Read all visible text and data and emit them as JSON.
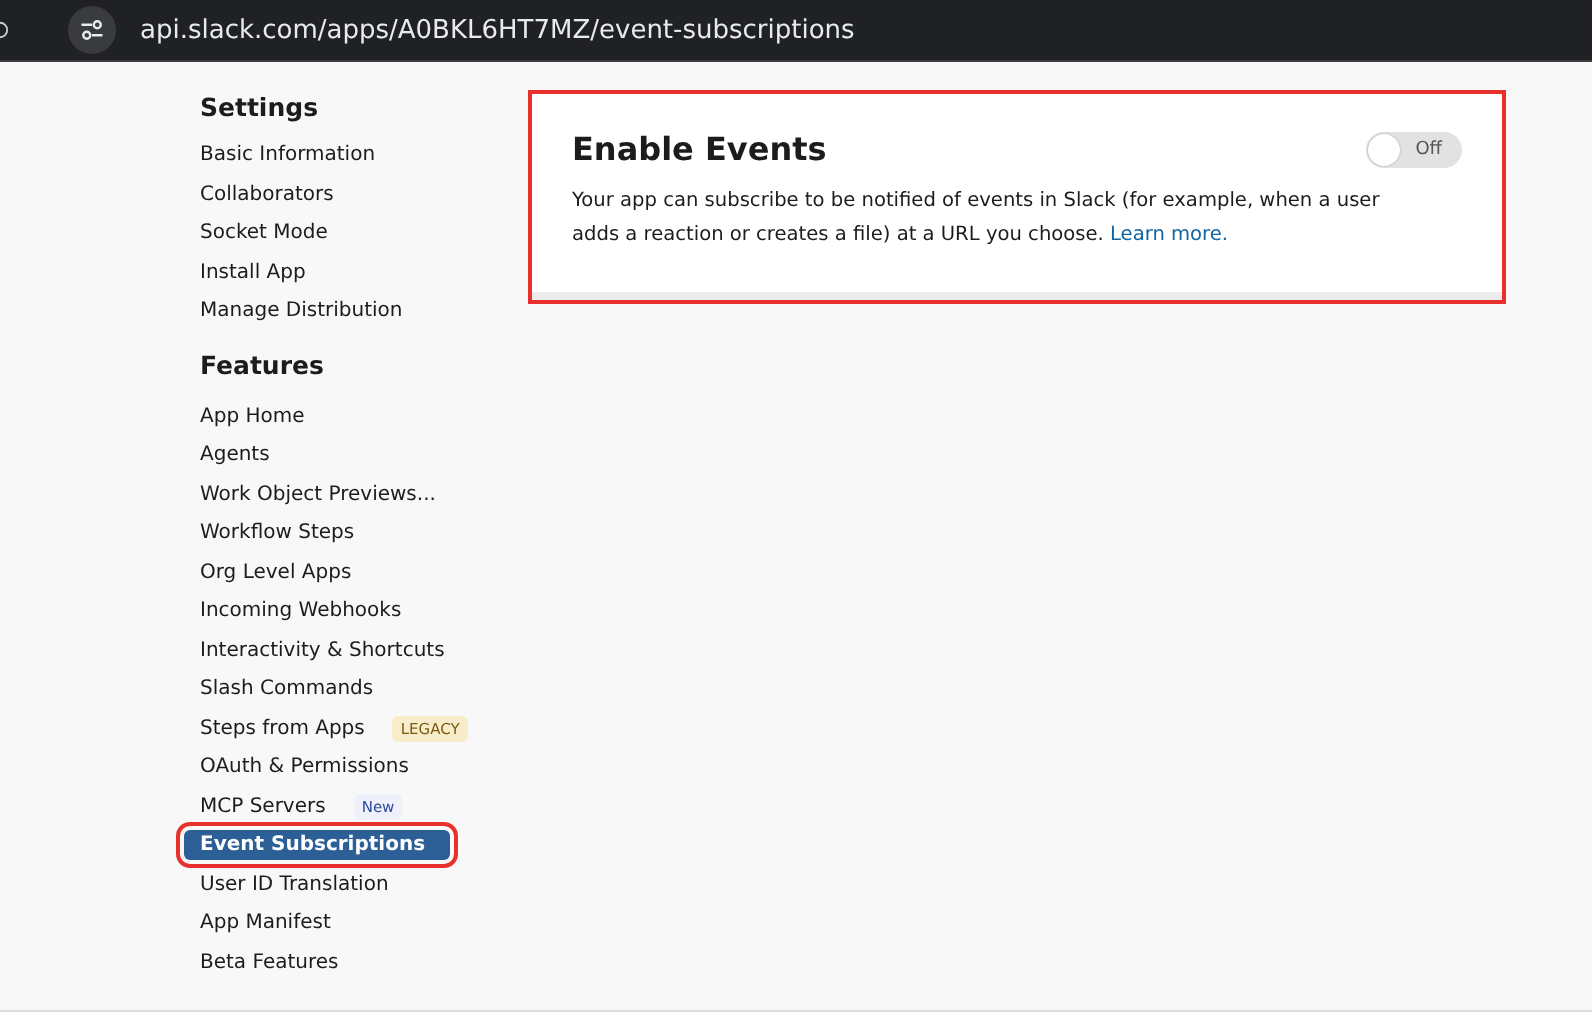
{
  "address_bar": {
    "url": "api.slack.com/apps/A0BKL6HT7MZ/event-subscriptions"
  },
  "sidebar": {
    "sections": [
      {
        "title": "Settings",
        "items": [
          {
            "label": "Basic Information",
            "selected": false
          },
          {
            "label": "Collaborators",
            "selected": false
          },
          {
            "label": "Socket Mode",
            "selected": false
          },
          {
            "label": "Install App",
            "selected": false
          },
          {
            "label": "Manage Distribution",
            "selected": false
          }
        ]
      },
      {
        "title": "Features",
        "items": [
          {
            "label": "App Home",
            "selected": false
          },
          {
            "label": "Agents",
            "selected": false
          },
          {
            "label": "Work Object Previews...",
            "selected": false
          },
          {
            "label": "Workflow Steps",
            "selected": false
          },
          {
            "label": "Org Level Apps",
            "selected": false
          },
          {
            "label": "Incoming Webhooks",
            "selected": false
          },
          {
            "label": "Interactivity & Shortcuts",
            "selected": false
          },
          {
            "label": "Slash Commands",
            "selected": false
          },
          {
            "label": "Steps from Apps",
            "selected": false,
            "badge": "LEGACY",
            "kind": "legacy"
          },
          {
            "label": "OAuth & Permissions",
            "selected": false
          },
          {
            "label": "MCP Servers",
            "selected": false,
            "badge": "New",
            "kind": "new"
          },
          {
            "label": "Event Subscriptions",
            "selected": true
          },
          {
            "label": "User ID Translation",
            "selected": false
          },
          {
            "label": "App Manifest",
            "selected": false
          },
          {
            "label": "Beta Features",
            "selected": false
          }
        ]
      }
    ]
  },
  "card": {
    "title": "Enable Events",
    "toggle": {
      "label": "Off",
      "on": false
    },
    "description": "Your app can subscribe to be notified of events in Slack (for example, when a user adds a reaction or creates a file) at a URL you choose.",
    "link": "Learn more."
  }
}
